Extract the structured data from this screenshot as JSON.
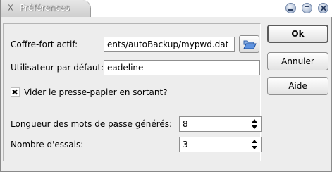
{
  "window": {
    "title": "Préférences",
    "controls": {
      "minimize": "minimize-icon",
      "maximize": "maximize-icon",
      "close": "close-icon"
    }
  },
  "form": {
    "vault_label": "Coffre-fort actif:",
    "vault_value": "ents/autoBackup/mypwd.dat",
    "user_label": "Utilisateur par défaut:",
    "user_value": "eadeline",
    "clipboard_label": "Vider le presse-papier en sortant?",
    "clipboard_checked": true,
    "length_label": "Longueur des mots de passe générés:",
    "length_value": "8",
    "tries_label": "Nombre d'essais:",
    "tries_value": "3"
  },
  "buttons": {
    "ok": "Ok",
    "cancel": "Annuler",
    "help": "Aide"
  },
  "icons": {
    "browse": "folder-open-icon"
  }
}
